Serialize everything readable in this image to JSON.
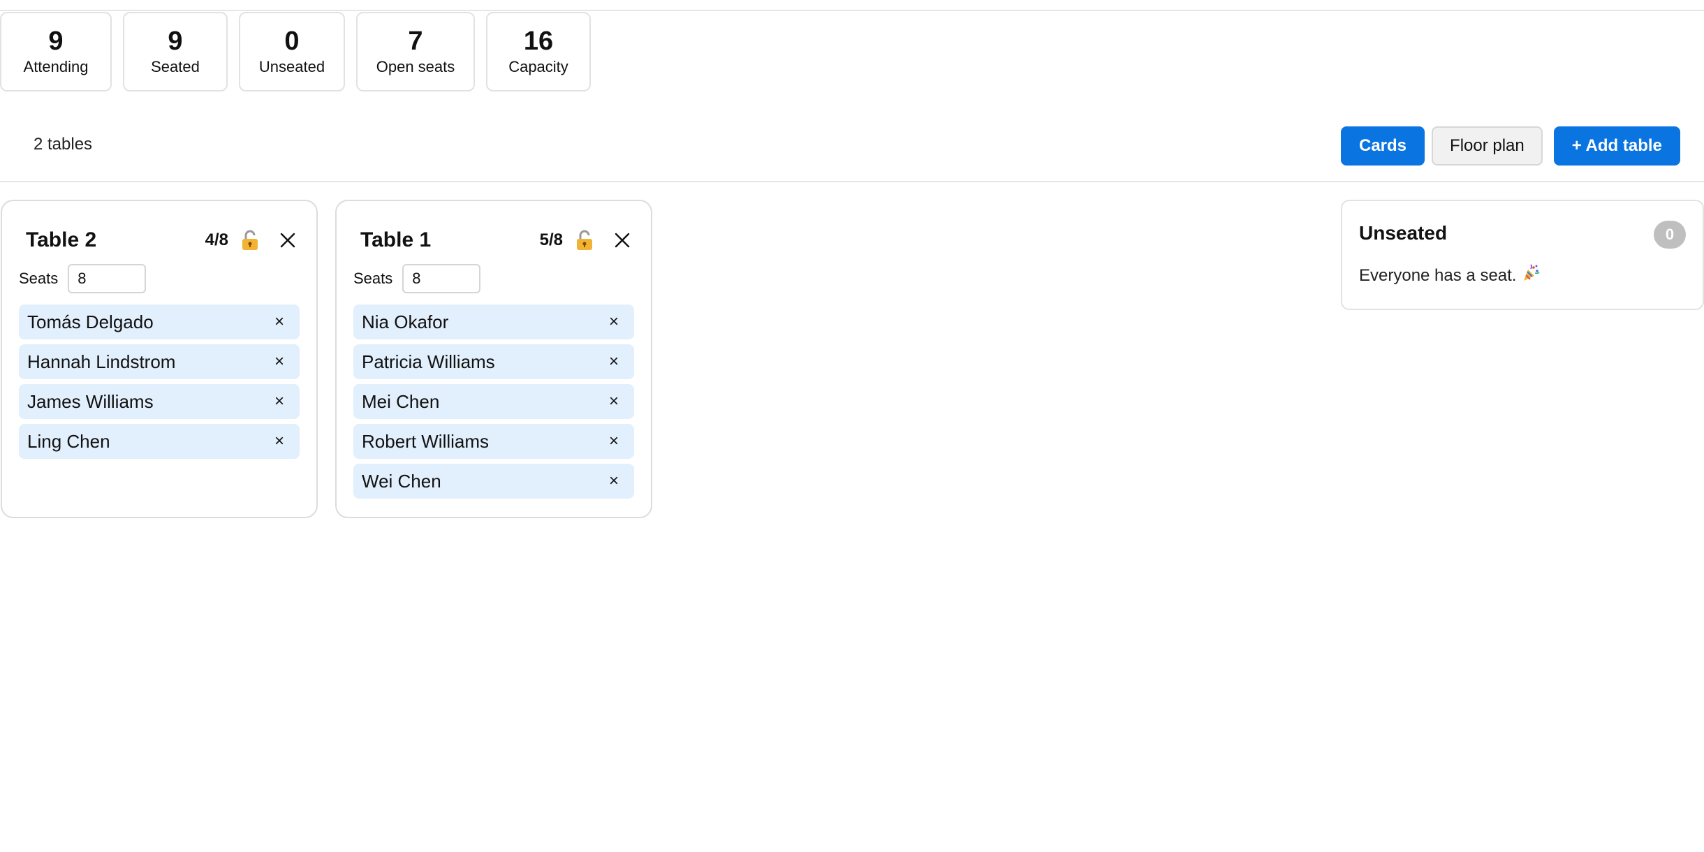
{
  "stats": [
    {
      "value": "9",
      "label": "Attending"
    },
    {
      "value": "9",
      "label": "Seated"
    },
    {
      "value": "0",
      "label": "Unseated"
    },
    {
      "value": "7",
      "label": "Open seats"
    },
    {
      "value": "16",
      "label": "Capacity"
    }
  ],
  "toolbar": {
    "table_count": "2 tables",
    "cards_label": "Cards",
    "floor_plan_label": "Floor plan",
    "add_table_label": "+ Add table"
  },
  "tables": [
    {
      "title": "Table 2",
      "count": "4/8",
      "seats_label": "Seats",
      "seats_value": "8",
      "guests": [
        "Tomás Delgado",
        "Hannah Lindstrom",
        "James Williams",
        "Ling Chen"
      ]
    },
    {
      "title": "Table 1",
      "count": "5/8",
      "seats_label": "Seats",
      "seats_value": "8",
      "guests": [
        "Nia Okafor",
        "Patricia Williams",
        "Mei Chen",
        "Robert Williams",
        "Wei Chen"
      ]
    }
  ],
  "unseated": {
    "title": "Unseated",
    "count": "0",
    "message": "Everyone has a seat."
  },
  "icons": {
    "remove_glyph": "×",
    "lock": "unlocked-padlock-icon",
    "close": "close-icon",
    "party": "party-popper-icon"
  },
  "colors": {
    "primary": "#0a74e0",
    "guest_chip": "#e2effc",
    "badge": "#bfbfbf",
    "lock": "#f2b233"
  }
}
